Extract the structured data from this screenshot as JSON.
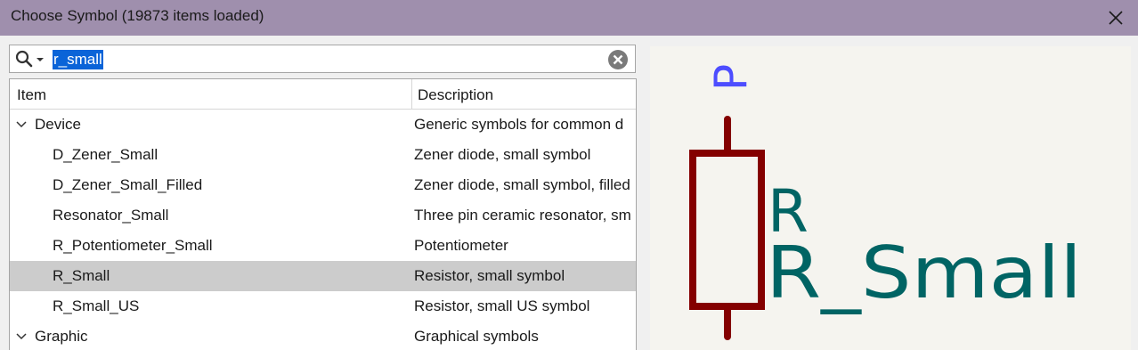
{
  "window": {
    "title": "Choose Symbol (19873 items loaded)"
  },
  "search": {
    "value": "r_small"
  },
  "tree": {
    "columns": {
      "item": "Item",
      "description": "Description"
    },
    "rows": [
      {
        "name": "Device",
        "description": "Generic symbols for common d",
        "group": true,
        "expanded": true
      },
      {
        "name": "D_Zener_Small",
        "description": "Zener diode, small symbol"
      },
      {
        "name": "D_Zener_Small_Filled",
        "description": "Zener diode, small symbol, filled"
      },
      {
        "name": "Resonator_Small",
        "description": "Three pin ceramic resonator, sm"
      },
      {
        "name": "R_Potentiometer_Small",
        "description": "Potentiometer"
      },
      {
        "name": "R_Small",
        "description": "Resistor, small symbol",
        "selected": true
      },
      {
        "name": "R_Small_US",
        "description": "Resistor, small US symbol"
      },
      {
        "name": "Graphic",
        "description": "Graphical symbols",
        "group": true,
        "expanded": false
      }
    ]
  },
  "preview": {
    "pin_label": "P",
    "reference": "R",
    "value": "R_Small",
    "colors": {
      "body": "#840000",
      "reference": "#006464",
      "pin": "#4d4dff",
      "background": "#f5f4ef"
    }
  }
}
